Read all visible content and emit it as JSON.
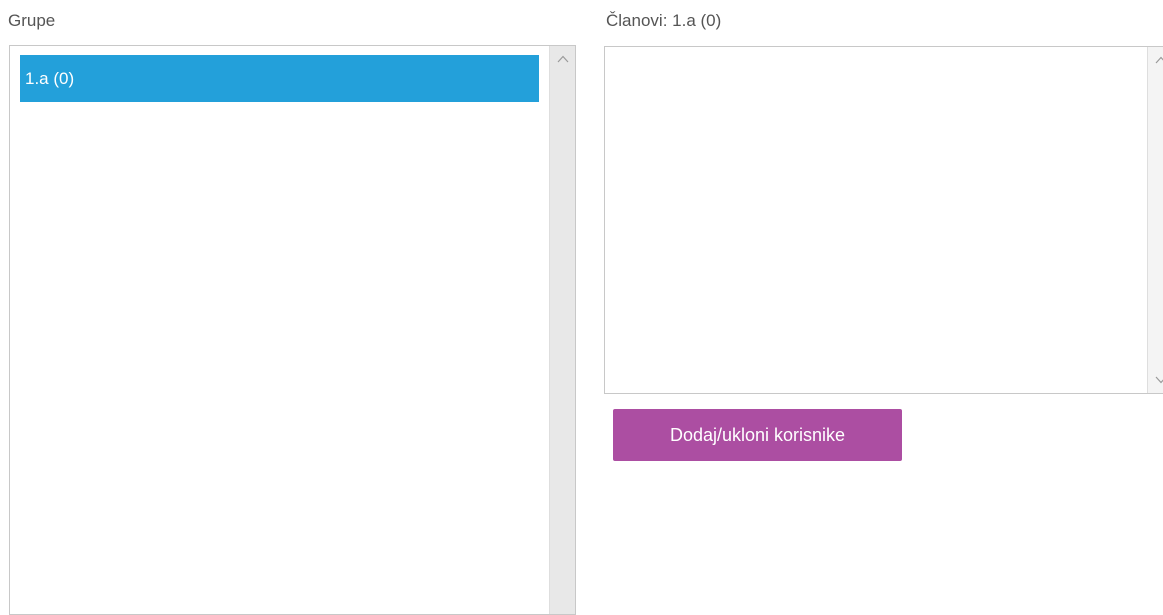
{
  "groups": {
    "label": "Grupe",
    "items": [
      {
        "label": "1.a (0)",
        "selected": true
      }
    ]
  },
  "members": {
    "label": "Članovi: 1.a (0)",
    "items": []
  },
  "actions": {
    "add_remove_label": "Dodaj/ukloni korisnike"
  },
  "colors": {
    "selected_item": "#23a0da",
    "button": "#ac4ea2",
    "label_text": "#555555",
    "border": "#c8c8c8",
    "scrollbar": "#e8e8e8"
  },
  "icons": {
    "scroll_up": "chevron-up-icon",
    "scroll_down": "chevron-down-icon"
  }
}
